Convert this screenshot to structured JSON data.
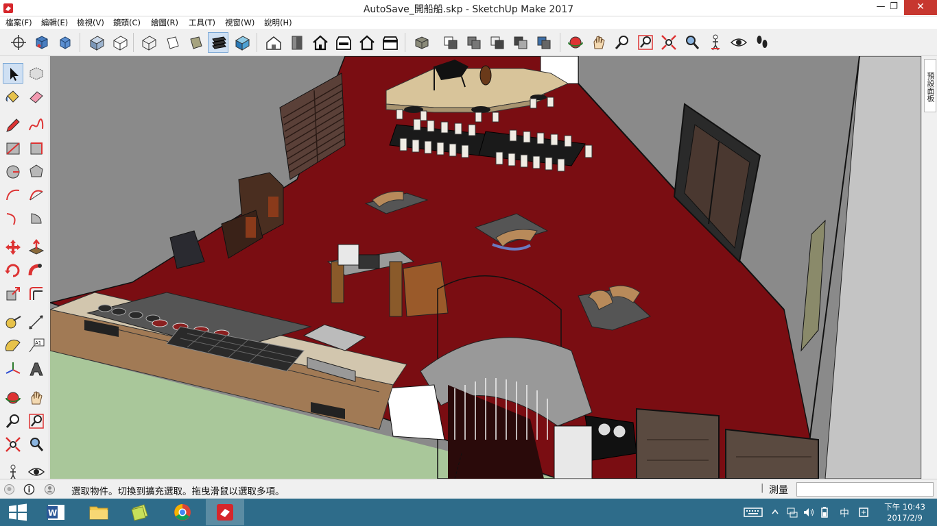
{
  "window": {
    "title": "AutoSave_開船船.skp - SketchUp Make 2017",
    "minimize_glyph": "—",
    "maximize_glyph": "❐",
    "close_glyph": "✕"
  },
  "menu": {
    "items": [
      "檔案(F)",
      "編輯(E)",
      "檢視(V)",
      "鏡頭(C)",
      "繪圖(R)",
      "工具(T)",
      "視窗(W)",
      "說明(H)"
    ]
  },
  "toolbar": {
    "buttons": [
      "orbit-crosshair-icon",
      "component-box-icon",
      "component-box-2-icon",
      "solid-box-icon",
      "wireframe-box-icon",
      "x-ray-icon",
      "back-edges-icon",
      "hidden-line-icon",
      "shaded-icon",
      "shaded-textures-icon",
      "monochrome-icon",
      "iso-view-icon",
      "top-view-icon",
      "front-view-icon",
      "right-view-icon",
      "back-view-icon",
      "left-view-icon",
      "outer-shell-icon",
      "intersect-icon",
      "union-icon",
      "subtract-icon",
      "trim-icon",
      "split-icon",
      "orbit-icon",
      "pan-icon",
      "zoom-icon",
      "zoom-window-icon",
      "zoom-extents-icon",
      "previous-view-icon",
      "position-camera-icon",
      "look-around-icon",
      "walk-icon"
    ]
  },
  "left_tools": [
    "select-arrow-icon",
    "make-component-icon",
    "paint-bucket-icon",
    "eraser-icon",
    "pencil-icon",
    "freehand-icon",
    "rectangle-icon",
    "rotated-rectangle-icon",
    "circle-icon",
    "polygon-icon",
    "arc-icon",
    "two-point-arc-icon",
    "three-point-arc-icon",
    "pie-icon",
    "move-icon",
    "push-pull-icon",
    "rotate-icon",
    "follow-me-icon",
    "scale-icon",
    "offset-icon",
    "tape-measure-icon",
    "dimension-icon",
    "protractor-icon",
    "text-label-icon",
    "axes-icon",
    "3d-text-icon",
    "orbit-icon",
    "pan-icon",
    "zoom-icon",
    "zoom-window-icon",
    "zoom-extents-icon",
    "previous-icon",
    "position-camera-icon",
    "look-around-icon"
  ],
  "tray": {
    "tab_label": "預設面板"
  },
  "status": {
    "message": "選取物件。切換到擴充選取。拖曳滑鼠以選取多項。",
    "separator": "|",
    "measure_label": "測量",
    "measure_value": ""
  },
  "taskbar": {
    "apps": [
      "word-app-icon",
      "file-explorer-icon",
      "sticky-notes-icon",
      "chrome-icon",
      "sketchup-icon"
    ],
    "tray_icons": [
      "keyboard-icon",
      "show-hidden-icon",
      "network-icon",
      "volume-icon",
      "battery-icon",
      "ime-icon",
      "action-center-icon"
    ],
    "ime_label": "中",
    "time": "下午 10:43",
    "date": "2017/2/9"
  },
  "colors": {
    "floor": "#7a0d12",
    "wall_grey": "#8a8a8a",
    "wall_light": "#bdbdbd",
    "grass": "#a9c79a",
    "close_button": "#c7372f",
    "taskbar": "#2e6c8a"
  }
}
